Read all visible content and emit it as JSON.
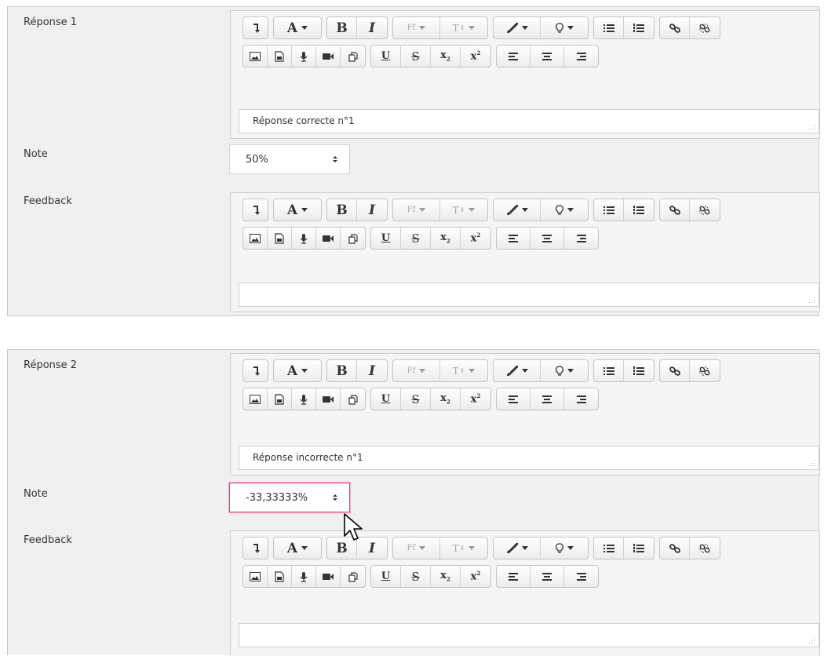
{
  "toolbar_icons": {
    "row1": [
      "collapse-icon",
      "font-color-icon",
      "bold-icon",
      "italic-icon",
      "font-family-icon",
      "font-size-icon",
      "style-brush-icon",
      "lightbulb-icon",
      "unordered-list-icon",
      "ordered-list-icon",
      "link-icon",
      "unlink-icon"
    ],
    "row2": [
      "image-icon",
      "media-file-icon",
      "record-audio-icon",
      "record-video-icon",
      "manage-files-icon",
      "underline-icon",
      "strikethrough-icon",
      "subscript-icon",
      "superscript-icon",
      "align-left-icon",
      "align-center-icon",
      "align-right-icon"
    ]
  },
  "toolbar_text": {
    "font_color": "A",
    "bold": "B",
    "italic": "I",
    "font_family": "Ff",
    "font_size": "T",
    "underline": "U",
    "strike": "S",
    "sub": "x",
    "sub_mark": "2",
    "sup": "x",
    "sup_mark": "2"
  },
  "answers": [
    {
      "label": "Réponse 1",
      "text": "Réponse correcte n°1",
      "grade_label": "Note",
      "grade_value": "50%",
      "feedback_label": "Feedback",
      "feedback_text": ""
    },
    {
      "label": "Réponse 2",
      "text": "Réponse incorrecte n°1",
      "grade_label": "Note",
      "grade_value": "-33,33333%",
      "grade_focused": true,
      "feedback_label": "Feedback",
      "feedback_text": ""
    }
  ],
  "colors": {
    "panel_bg": "#f0f0f0",
    "focus_border": "#ea3d74",
    "text": "#333333"
  },
  "cursor": "arrow-pointer"
}
